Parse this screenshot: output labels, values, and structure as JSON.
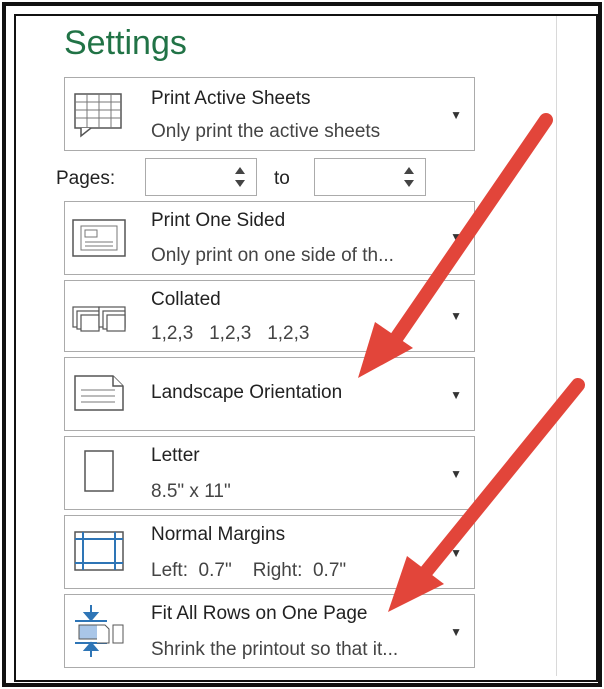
{
  "settings": {
    "title": "Settings"
  },
  "print_what": {
    "title": "Print Active Sheets",
    "subtitle": "Only print the active sheets",
    "icon": "sheet-grid-icon"
  },
  "pages": {
    "label": "Pages:",
    "from_value": "",
    "to_label": "to",
    "to_value": ""
  },
  "sides": {
    "title": "Print One Sided",
    "subtitle": "Only print on one side of th...",
    "icon": "one-sided-icon"
  },
  "collation": {
    "title": "Collated",
    "subtitle": "1,2,3   1,2,3   1,2,3",
    "icon": "collated-icon"
  },
  "orientation": {
    "title": "Landscape Orientation",
    "icon": "landscape-page-icon"
  },
  "paper": {
    "title": "Letter",
    "subtitle": "8.5\" x 11\"",
    "icon": "paper-size-icon"
  },
  "margins": {
    "title": "Normal Margins",
    "subtitle": "Left:  0.7\"    Right:  0.7\"",
    "icon": "margins-icon"
  },
  "scaling": {
    "title": "Fit All Rows on One Page",
    "subtitle": "Shrink the printout so that it...",
    "icon": "fit-rows-icon"
  },
  "colors": {
    "title_green": "#217346",
    "arrow_red": "#e2453a",
    "border_gray": "#ababab"
  }
}
